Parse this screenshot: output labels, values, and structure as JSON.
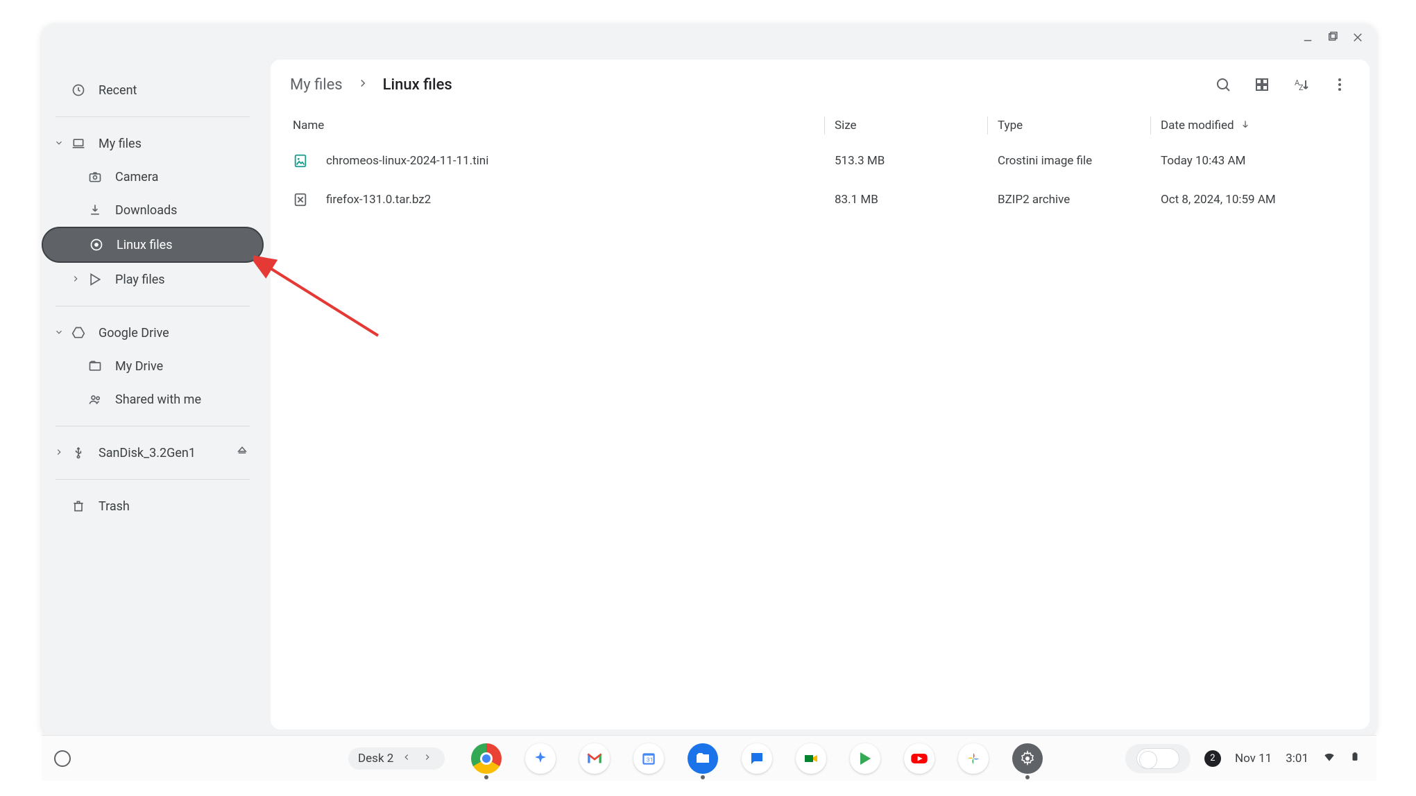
{
  "window": {
    "minimize": "minimize",
    "maximize": "maximize",
    "close": "close"
  },
  "sidebar": {
    "recent": "Recent",
    "myfiles": "My files",
    "camera": "Camera",
    "downloads": "Downloads",
    "linux": "Linux files",
    "play": "Play files",
    "gdrive": "Google Drive",
    "mydrive": "My Drive",
    "shared": "Shared with me",
    "usb": "SanDisk_3.2Gen1",
    "trash": "Trash"
  },
  "breadcrumb": {
    "root": "My files",
    "current": "Linux files"
  },
  "columns": {
    "name": "Name",
    "size": "Size",
    "type": "Type",
    "date": "Date modified"
  },
  "files": [
    {
      "name": "chromeos-linux-2024-11-11.tini",
      "size": "513.3 MB",
      "type": "Crostini image file",
      "date": "Today 10:43 AM"
    },
    {
      "name": "firefox-131.0.tar.bz2",
      "size": "83.1 MB",
      "type": "BZIP2 archive",
      "date": "Oct 8, 2024, 10:59 AM"
    }
  ],
  "shelf": {
    "desk_label": "Desk 2",
    "notif_count": "2",
    "date": "Nov 11",
    "time": "3:01",
    "apps": [
      "chrome",
      "gemini",
      "gmail",
      "calendar",
      "files",
      "messages",
      "meet",
      "play",
      "youtube",
      "photos",
      "settings"
    ]
  }
}
